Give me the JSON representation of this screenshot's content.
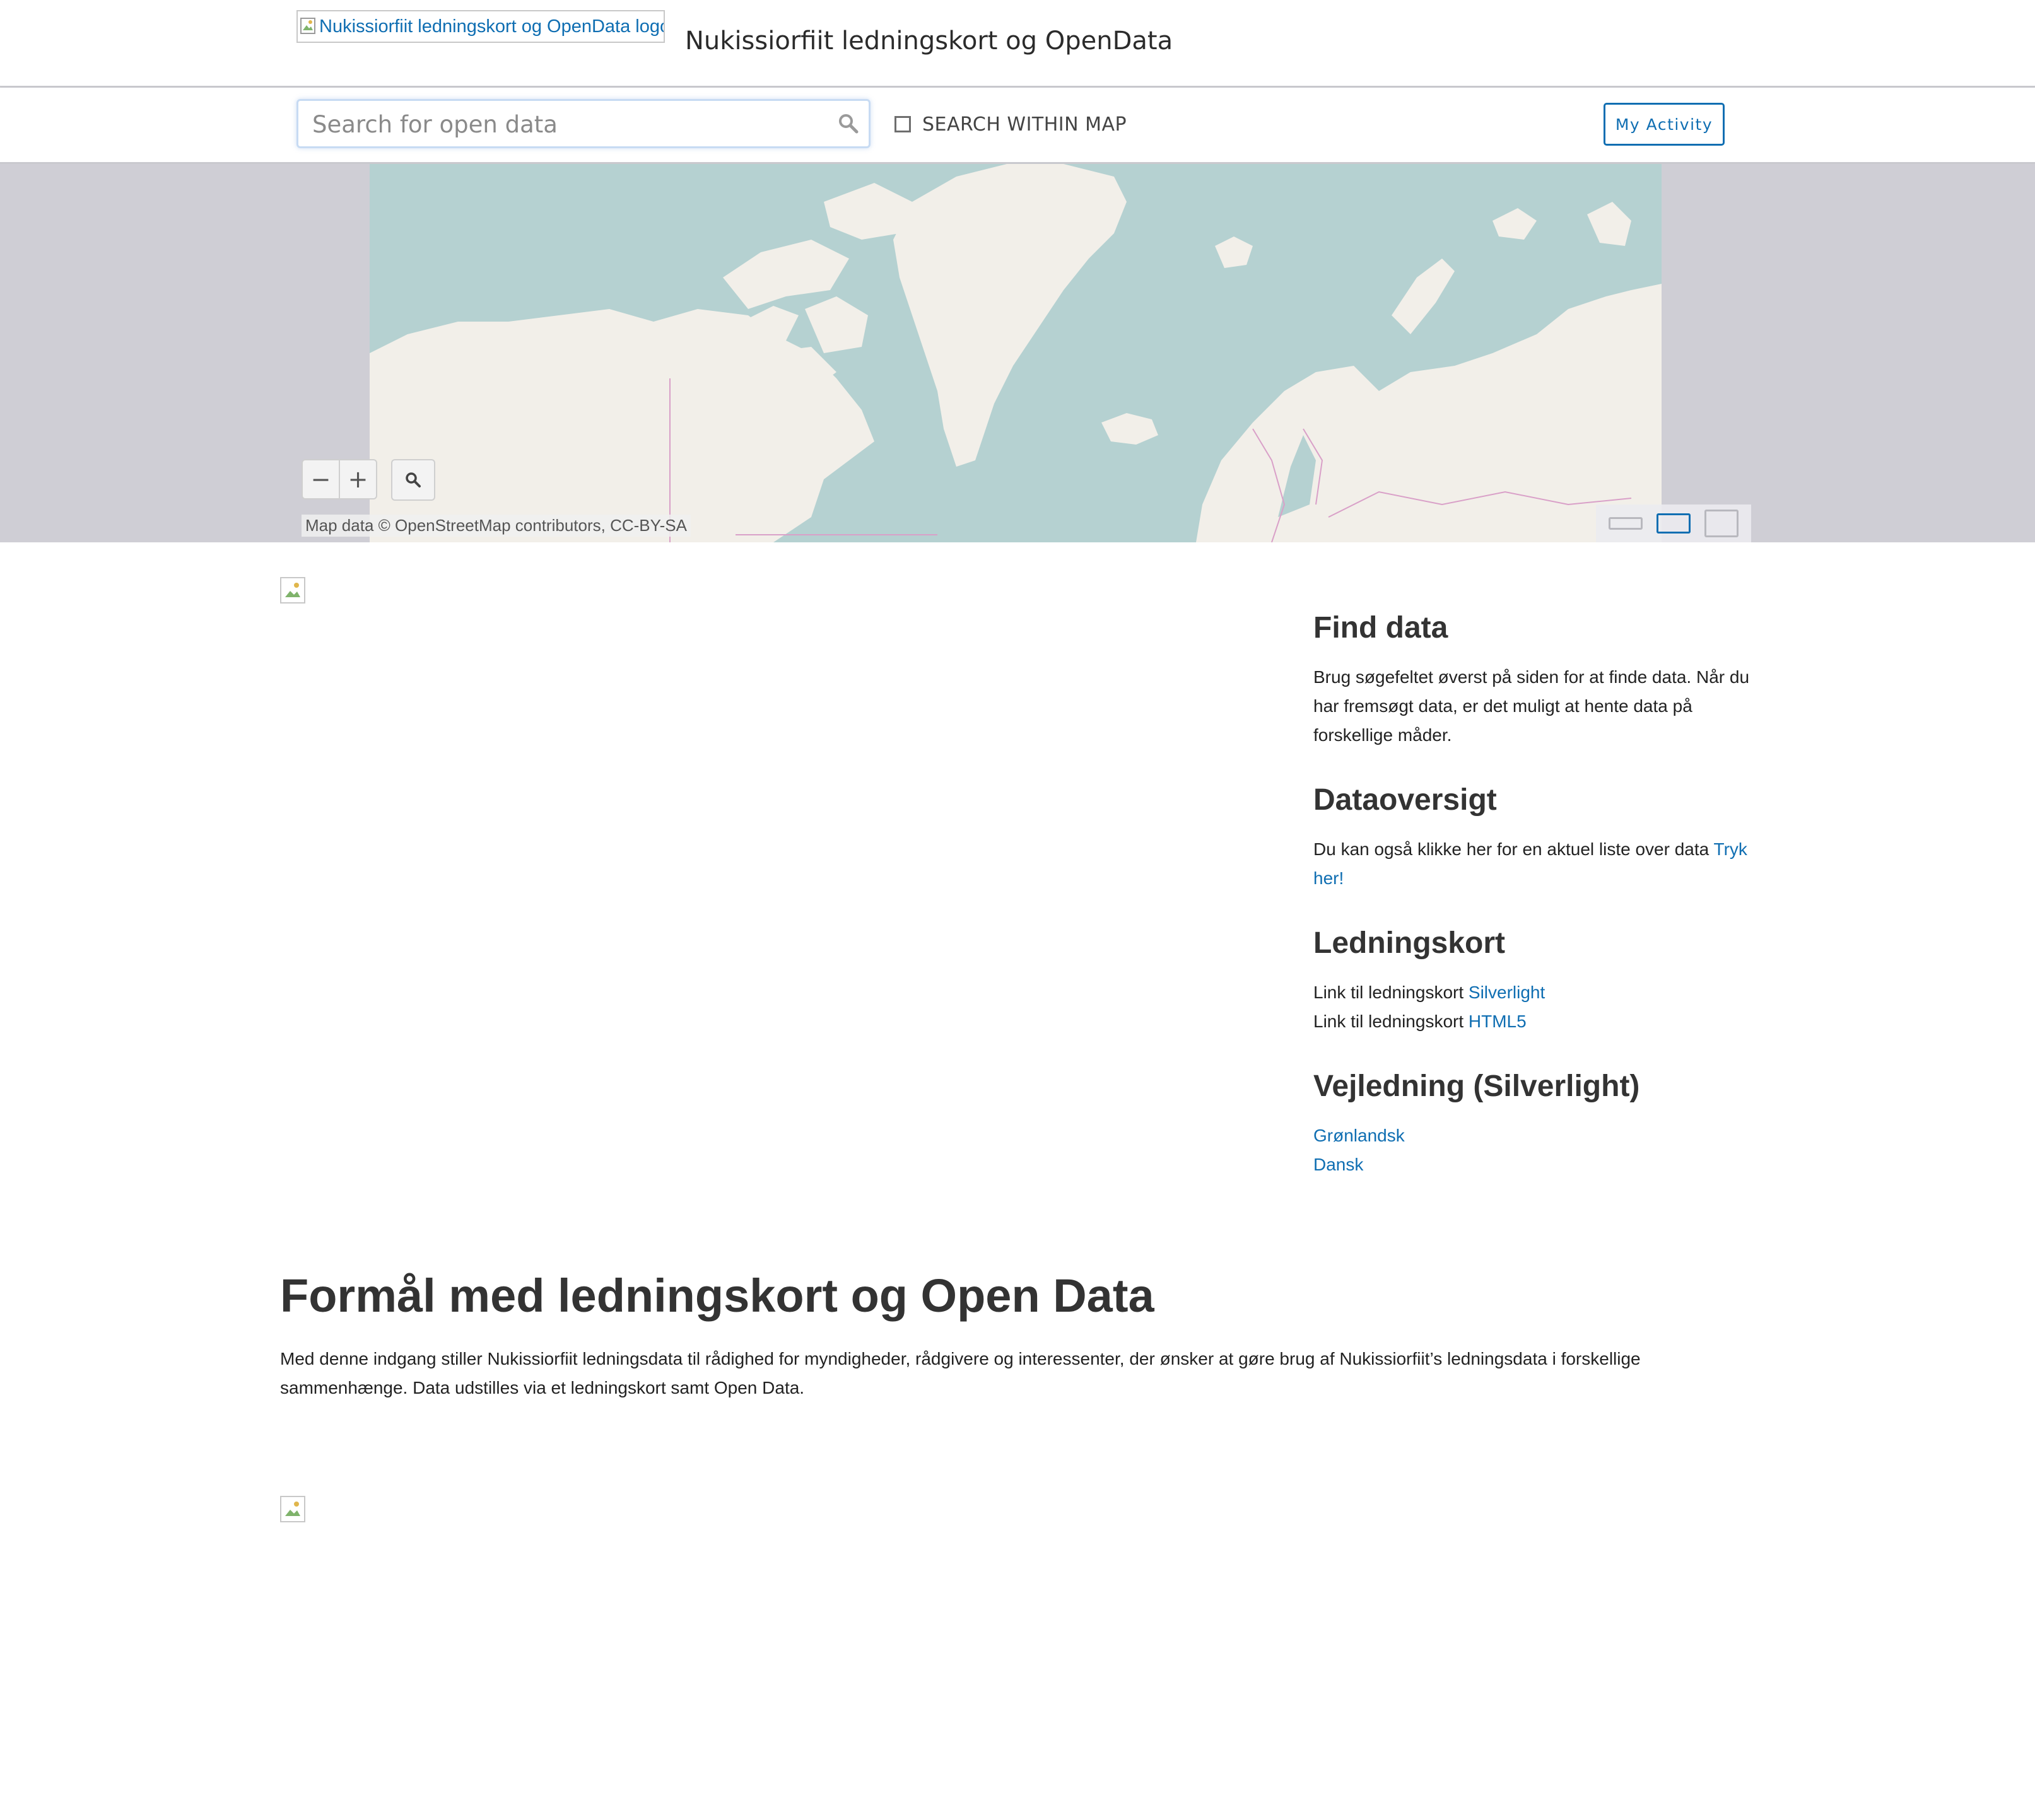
{
  "header": {
    "logo_alt": "Nukissiorfiit ledningskort og OpenData logo",
    "site_title": "Nukissiorfiit ledningskort og OpenData"
  },
  "search": {
    "placeholder": "Search for open data",
    "within_map_label": "SEARCH WITHIN MAP",
    "within_map_checked": false,
    "my_activity_label": "My Activity"
  },
  "map": {
    "zoom_out_label": "−",
    "zoom_in_label": "+",
    "attribution": "Map data © OpenStreetMap contributors, CC-BY-SA",
    "selected_size": "medium",
    "colors": {
      "water": "#b5d1d1",
      "land": "#f2efe9",
      "border": "#d9a0c8",
      "frame": "#cfced5"
    }
  },
  "sidebar": {
    "find_data": {
      "heading": "Find data",
      "text": "Brug søgefeltet øverst på siden for at finde data. Når du har fremsøgt data, er det muligt at hente data på forskellige måder."
    },
    "data_overview": {
      "heading": "Dataoversigt",
      "text": "Du kan også klikke her for en aktuel liste over data",
      "link": "Tryk her!"
    },
    "ledningskort": {
      "heading": "Ledningskort",
      "items": [
        {
          "prefix": "Link til ledningskort",
          "link": "Silverlight"
        },
        {
          "prefix": "Link til ledningskort",
          "link": "HTML5"
        }
      ]
    },
    "guide": {
      "heading": "Vejledning (Silverlight)",
      "links": [
        "Grønlandsk",
        "Dansk"
      ]
    }
  },
  "purpose": {
    "heading": "Formål med ledningskort og Open Data",
    "text": "Med denne indgang stiller Nukissiorfiit ledningsdata til rådighed for myndigheder, rådgivere og interessenter, der ønsker at gøre brug af Nukissiorfiit’s ledningsdata i forskellige sammenhænge. Data udstilles via et ledningskort samt Open Data."
  },
  "theme": {
    "link_color": "#0f6eb2",
    "text_color": "#333333"
  }
}
